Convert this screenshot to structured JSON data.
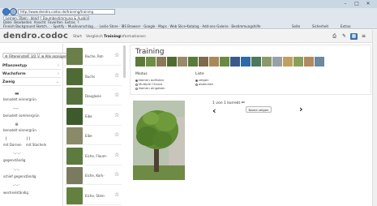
{
  "browser": {
    "url": "http://www.dendro.codoc.de/training/training",
    "tabs": [
      "Lernen, Üben - dendro.codoc",
      "Baumbestimmung & Ausbildung"
    ],
    "menu": [
      "Datei",
      "Bearbeiten",
      "Ansicht",
      "Favoriten",
      "Extras",
      "?"
    ],
    "favorites": [
      "Finnish Background Sketch...",
      "Spotify – Musikvorschlag...",
      "Leslie Store",
      "IBS Browser",
      "Google",
      "Maps",
      "Web Slice-Katalog",
      "Add-ons-Galerie",
      "Bestimmungshilfe"
    ],
    "controls": [
      "Seite",
      "Sicherheit",
      "Extras"
    ]
  },
  "app": {
    "logo": "dendro.codoc",
    "nav": [
      "Start",
      "Vergleich",
      "Training",
      "Informationen"
    ],
    "active_nav": "Training",
    "header_icons": [
      "print-icon",
      "wrench-icon",
      "grid-icon",
      "list-icon"
    ]
  },
  "filter": {
    "buttons": [
      "Filtereinstellungen",
      "Alle anzeigen"
    ],
    "count_label": "3/2",
    "sections": [
      "Pflanzentyp",
      "Wuchsform",
      "Zweig"
    ],
    "leaf_labels": [
      "benadelt einnergrün",
      "benadelt sommergrün",
      "benadelt einnergrün",
      "mit Dornen",
      "mit Stacheln",
      "gegenständig",
      "schief gegenständig",
      "wechselständig"
    ]
  },
  "species": [
    {
      "name": "Buche, Rot-",
      "color": "#6b7f4a"
    },
    {
      "name": "Buchs",
      "color": "#4f6b35"
    },
    {
      "name": "Douglasie",
      "color": "#56703c"
    },
    {
      "name": "Eibe",
      "color": "#3e5a2c"
    },
    {
      "name": "Eibe",
      "color": "#8a8a6a"
    },
    {
      "name": "Eiche, Flaum-",
      "color": "#5d7a3f"
    },
    {
      "name": "Eiche, Kork-",
      "color": "#7a7a5e"
    },
    {
      "name": "Eiche, Stein-",
      "color": "#63803f"
    }
  ],
  "training": {
    "title": "Training",
    "strip_colors": [
      "#5c7a3a",
      "#6f8e45",
      "#8a7a5a",
      "#4f6b30",
      "#9a8a6a",
      "#5a7a3c",
      "#7d6b4d",
      "#a88a5a",
      "#6a8a42",
      "#3b5a8a",
      "#2e6aa8",
      "#4a7a5a",
      "#8a9a6a",
      "#9aa0a8",
      "#c0a060",
      "#8aa05a",
      "#b08a60",
      "#6a8aa0"
    ],
    "modus_label": "Modus",
    "modus_options": [
      "Namen auflisten",
      "Multiple Choice",
      "Namen eingeben"
    ],
    "modus_selected": 0,
    "liste_label": "Liste",
    "liste_options": [
      "zeigen",
      "abdecken"
    ],
    "liste_selected": 0,
    "counter": "1 von 1 korrekt",
    "show_name": "Name zeigen"
  }
}
